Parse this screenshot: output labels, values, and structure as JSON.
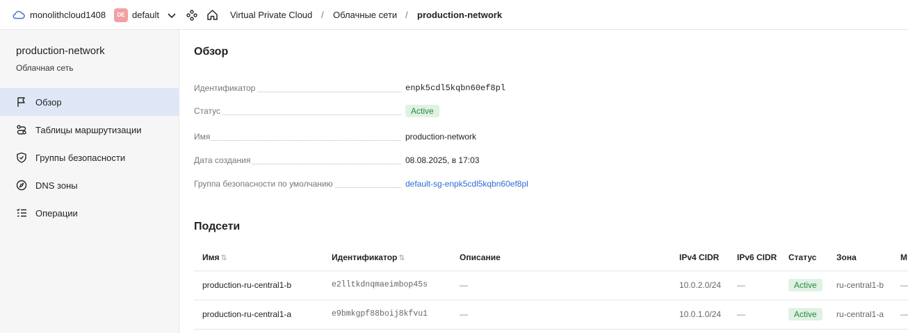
{
  "header": {
    "cloud_name": "monolithcloud1408",
    "folder_badge": "DE",
    "folder_name": "default",
    "breadcrumbs": [
      "Virtual Private Cloud",
      "Облачные сети",
      "production-network"
    ],
    "separator": "/"
  },
  "sidebar": {
    "title": "production-network",
    "subtitle": "Облачная сеть",
    "items": [
      {
        "label": "Обзор",
        "icon": "flag-icon",
        "active": true
      },
      {
        "label": "Таблицы маршрутизации",
        "icon": "route-icon",
        "active": false
      },
      {
        "label": "Группы безопасности",
        "icon": "shield-icon",
        "active": false
      },
      {
        "label": "DNS зоны",
        "icon": "compass-icon",
        "active": false
      },
      {
        "label": "Операции",
        "icon": "list-icon",
        "active": false
      }
    ]
  },
  "overview": {
    "title": "Обзор",
    "props": [
      {
        "label": "Идентификатор",
        "value": "enpk5cdl5kqbn60ef8pl"
      },
      {
        "label": "Статус",
        "value": "Active"
      },
      {
        "label": "Имя",
        "value": "production-network"
      },
      {
        "label": "Дата создания",
        "value": "08.08.2025, в 17:03"
      },
      {
        "label": "Группа безопасности по умолчанию",
        "value": "default-sg-enpk5cdl5kqbn60ef8pl"
      }
    ]
  },
  "subnets": {
    "title": "Подсети",
    "columns": [
      "Имя",
      "Идентификатор",
      "Описание",
      "IPv4 CIDR",
      "IPv6 CIDR",
      "Статус",
      "Зона",
      "М"
    ],
    "sort_icon": "⇅",
    "rows": [
      {
        "name": "production-ru-central1-b",
        "id": "e2lltkdnqmaeimbop45s",
        "description": "—",
        "ipv4": "10.0.2.0/24",
        "ipv6": "—",
        "status": "Active",
        "zone": "ru-central1-b",
        "extra": "—"
      },
      {
        "name": "production-ru-central1-a",
        "id": "e9bmkgpf88boij8kfvu1",
        "description": "—",
        "ipv4": "10.0.1.0/24",
        "ipv6": "—",
        "status": "Active",
        "zone": "ru-central1-a",
        "extra": "—"
      }
    ]
  },
  "colors": {
    "accent": "#2e6bd9",
    "active_bg": "#dff2e3",
    "active_text": "#27883c",
    "nav_active": "#dfe6f6"
  }
}
